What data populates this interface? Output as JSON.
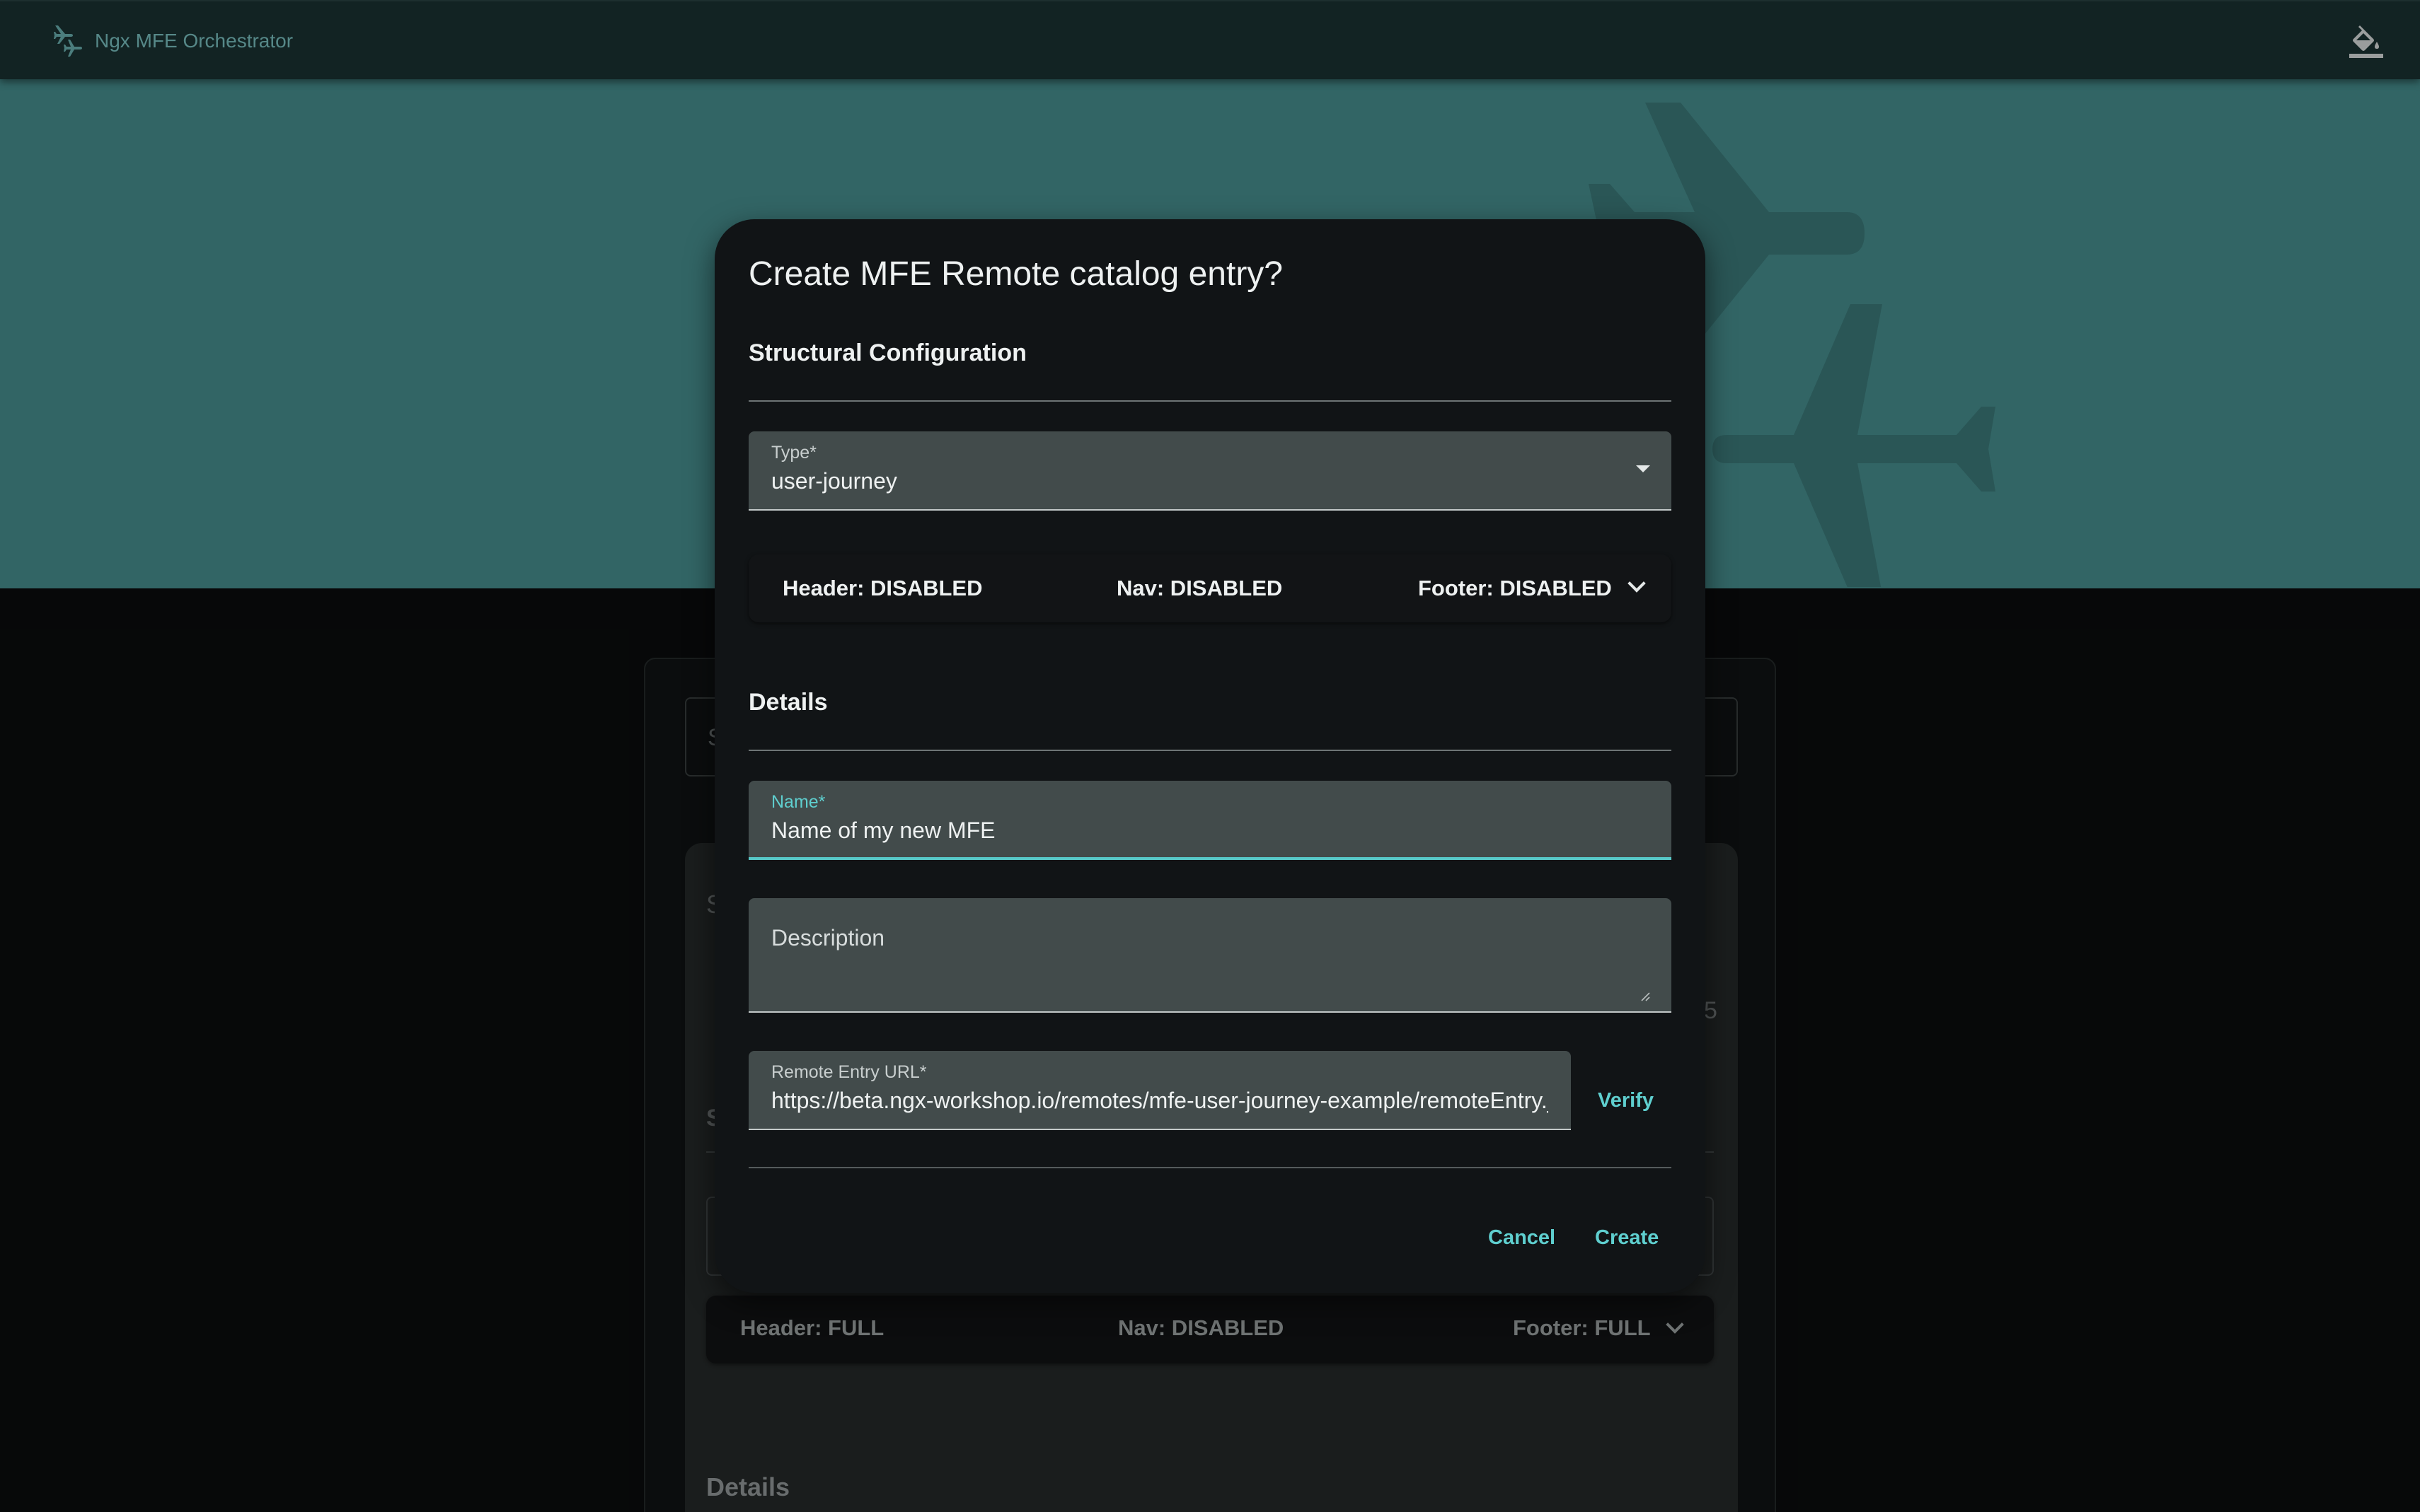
{
  "app": {
    "title": "Ngx MFE Orchestrator",
    "logo_icon": "airplanes-icon",
    "theme_button_icon": "format-color-fill-icon"
  },
  "colors": {
    "toolbar": "#1b3434",
    "hero": "#4a9595",
    "accent": "#5fcfcf",
    "dialog_bg": "#111416",
    "field_bg": "#424b4b"
  },
  "background": {
    "search_char": "S",
    "section_char": "S",
    "section_char_2": "S",
    "trailing_digit": "5",
    "layout": {
      "header": "Header: FULL",
      "nav": "Nav: DISABLED",
      "footer": "Footer: FULL"
    },
    "details_title": "Details"
  },
  "dialog": {
    "title": "Create MFE Remote catalog entry?",
    "structural_title": "Structural Configuration",
    "type_field": {
      "label": "Type*",
      "value": "user-journey"
    },
    "layout": {
      "header": "Header: DISABLED",
      "nav": "Nav: DISABLED",
      "footer": "Footer: DISABLED"
    },
    "details_title": "Details",
    "name_field": {
      "label": "Name*",
      "value": "Name of my new MFE"
    },
    "description_field": {
      "placeholder": "Description",
      "value": ""
    },
    "remote_entry_field": {
      "label": "Remote Entry URL*",
      "value": "https://beta.ngx-workshop.io/remotes/mfe-user-journey-example/remoteEntry.js"
    },
    "verify_label": "Verify",
    "cancel_label": "Cancel",
    "create_label": "Create"
  }
}
